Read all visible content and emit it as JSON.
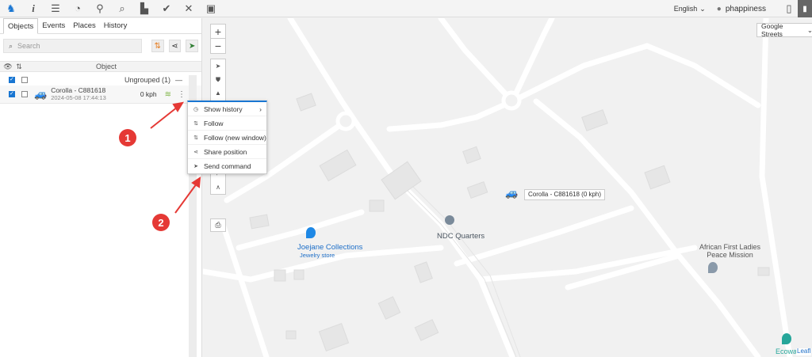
{
  "header": {
    "icons": [
      "home-icon",
      "info-icon",
      "sliders-icon",
      "dashboard-icon",
      "location-pin-icon",
      "search-icon",
      "chart-icon",
      "check-icon",
      "tools-icon",
      "window-icon"
    ],
    "language": "English",
    "username": "phappiness"
  },
  "sidebar": {
    "tabs": [
      "Objects",
      "Events",
      "Places",
      "History"
    ],
    "search_placeholder": "Search",
    "column_object": "Object",
    "group": {
      "label": "Ungrouped (1)"
    },
    "object": {
      "name": "Corolla - C881618",
      "time": "2024-05-08 17:44:13",
      "speed": "0 kph"
    }
  },
  "context_menu": {
    "items": [
      "Show history",
      "Follow",
      "Follow (new window)",
      "Share position",
      "Send command"
    ]
  },
  "map": {
    "type": "Google Streets",
    "vehicle_label": "Corolla - C881618 (0 kph)",
    "pois": {
      "ndc": "NDC Quarters",
      "joejane": "Joejane Collections",
      "joejane_sub": "Jewelry store",
      "african_line1": "African First Ladies",
      "african_line2": "Peace Mission",
      "ecowas": "Ecowa",
      "leaflet": "Leafl"
    }
  },
  "annotations": {
    "badge1": "1",
    "badge2": "2"
  },
  "colors": {
    "accent": "#1976d2",
    "badge": "#e53935",
    "vehicle": "#1565c0"
  }
}
